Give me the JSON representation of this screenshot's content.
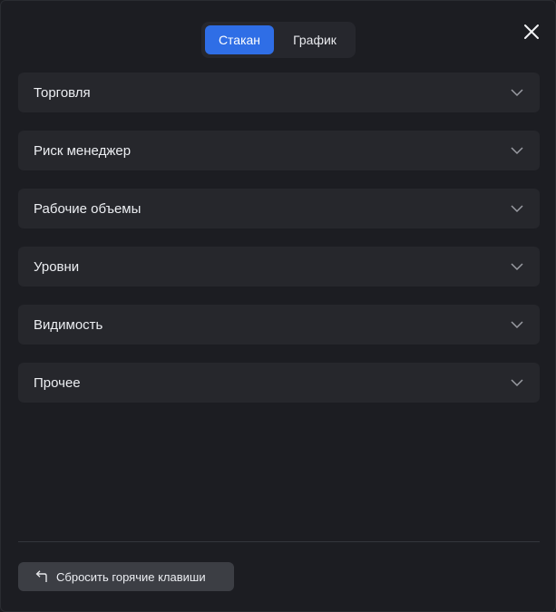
{
  "tabs": [
    {
      "label": "Стакан",
      "active": true
    },
    {
      "label": "График",
      "active": false
    }
  ],
  "close_icon": "close-icon",
  "sections": [
    {
      "label": "Торговля",
      "icon": "chevron-down-icon"
    },
    {
      "label": "Риск менеджер",
      "icon": "chevron-down-icon"
    },
    {
      "label": "Рабочие объемы",
      "icon": "chevron-down-icon"
    },
    {
      "label": "Уровни",
      "icon": "chevron-down-icon"
    },
    {
      "label": "Видимость",
      "icon": "chevron-down-icon"
    },
    {
      "label": "Прочее",
      "icon": "chevron-down-icon"
    }
  ],
  "reset": {
    "label": "Сбросить горячие клавиши",
    "icon": "undo-arrow-icon"
  },
  "colors": {
    "accent": "#2f6ee6",
    "background": "#1c1d22",
    "section_bg": "#26272c",
    "button_bg": "#3c3e44"
  }
}
